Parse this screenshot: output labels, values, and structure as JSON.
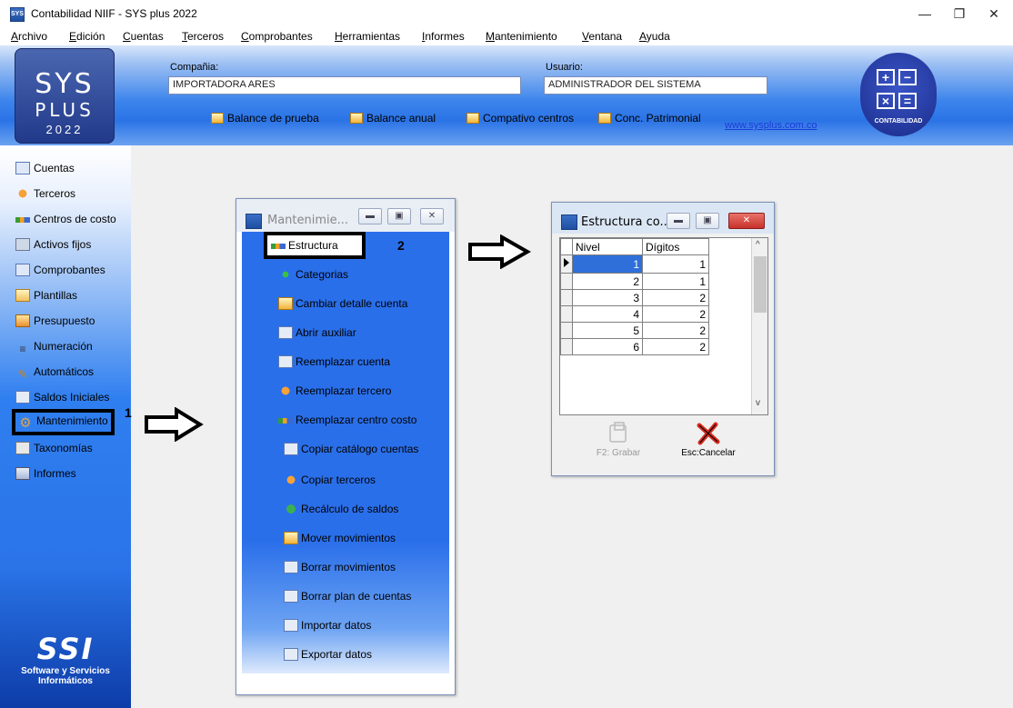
{
  "app": {
    "title": "Contabilidad NIIF - SYS plus 2022",
    "icon": "app-icon",
    "window_buttons": [
      "minimize",
      "restore",
      "close"
    ]
  },
  "menu": [
    {
      "label": "Archivo",
      "hot": "A"
    },
    {
      "label": "Edición",
      "hot": "E"
    },
    {
      "label": "Cuentas",
      "hot": "C"
    },
    {
      "label": "Terceros",
      "hot": "T"
    },
    {
      "label": "Comprobantes",
      "hot": "b"
    },
    {
      "label": "Herramientas",
      "hot": "H"
    },
    {
      "label": "Informes",
      "hot": "I"
    },
    {
      "label": "Mantenimiento",
      "hot": "M"
    },
    {
      "label": "Ventana",
      "hot": "V"
    },
    {
      "label": "Ayuda",
      "hot": "y"
    }
  ],
  "header": {
    "logo": {
      "line1": "SYS",
      "line2": "PLUS",
      "line3": "2022"
    },
    "company_label": "Compañia:",
    "company_value": "IMPORTADORA ARES",
    "user_label": "Usuario:",
    "user_value": "ADMINISTRADOR DEL SISTEMA",
    "quick_links": [
      "Balance de prueba",
      "Balance anual",
      "Compativo centros",
      "Conc. Patrimonial"
    ],
    "url": "www.sysplus.com.co",
    "module_badge": "CONTABILIDAD"
  },
  "sidebar": {
    "items": [
      {
        "label": "Cuentas",
        "icon": "ledger-icon"
      },
      {
        "label": "Terceros",
        "icon": "people-icon"
      },
      {
        "label": "Centros de costo",
        "icon": "org-chart-icon"
      },
      {
        "label": "Activos fijos",
        "icon": "building-icon"
      },
      {
        "label": "Comprobantes",
        "icon": "document-icon"
      },
      {
        "label": "Plantillas",
        "icon": "template-icon"
      },
      {
        "label": "Presupuesto",
        "icon": "budget-icon"
      },
      {
        "label": "Numeración",
        "icon": "numbering-icon"
      },
      {
        "label": "Automáticos",
        "icon": "wand-icon"
      },
      {
        "label": "Saldos Iniciales",
        "icon": "balance-icon"
      },
      {
        "label": "Mantenimiento",
        "icon": "gear-icon",
        "selected": true
      },
      {
        "label": "Taxonomías",
        "icon": "taxonomy-icon"
      },
      {
        "label": "Informes",
        "icon": "printer-icon"
      }
    ],
    "footer_logo": "SSI",
    "footer_text_1": "Software y Servicios",
    "footer_text_2": "Informáticos"
  },
  "annotations": {
    "step1": "1",
    "step2": "2"
  },
  "mantenimiento_window": {
    "title": "Mantenimie...",
    "items": [
      {
        "label": "Estructura",
        "icon": "structure-icon",
        "highlighted": true
      },
      {
        "label": "Categorias",
        "icon": "categories-icon"
      },
      {
        "label": "Cambiar detalle cuenta",
        "icon": "edit-account-icon"
      },
      {
        "label": "Abrir auxiliar",
        "icon": "open-aux-icon"
      },
      {
        "label": "Reemplazar cuenta",
        "icon": "replace-account-icon"
      },
      {
        "label": "Reemplazar tercero",
        "icon": "replace-person-icon"
      },
      {
        "label": "Reemplazar centro costo",
        "icon": "replace-cost-center-icon"
      },
      {
        "label": "Copiar catálogo cuentas",
        "icon": "copy-catalog-icon"
      },
      {
        "label": "Copiar terceros",
        "icon": "copy-people-icon"
      },
      {
        "label": "Recálculo de saldos",
        "icon": "recalc-icon"
      },
      {
        "label": "Mover movimientos",
        "icon": "move-icon"
      },
      {
        "label": "Borrar movimientos",
        "icon": "delete-movements-icon"
      },
      {
        "label": "Borrar plan de cuentas",
        "icon": "delete-plan-icon"
      },
      {
        "label": "Importar datos",
        "icon": "import-icon"
      },
      {
        "label": "Exportar datos",
        "icon": "export-icon"
      }
    ]
  },
  "estructura_window": {
    "title": "Estructura co...",
    "columns": [
      "Nivel",
      "Dígitos"
    ],
    "rows": [
      {
        "nivel": "1",
        "digitos": "1"
      },
      {
        "nivel": "2",
        "digitos": "1"
      },
      {
        "nivel": "3",
        "digitos": "2"
      },
      {
        "nivel": "4",
        "digitos": "2"
      },
      {
        "nivel": "5",
        "digitos": "2"
      },
      {
        "nivel": "6",
        "digitos": "2"
      }
    ],
    "save_label": "F2: Grabar",
    "cancel_label": "Esc:Cancelar"
  },
  "colors": {
    "accent_blue": "#2a6fea",
    "selection_blue": "#2f6fd9",
    "close_red": "#c8312a"
  }
}
